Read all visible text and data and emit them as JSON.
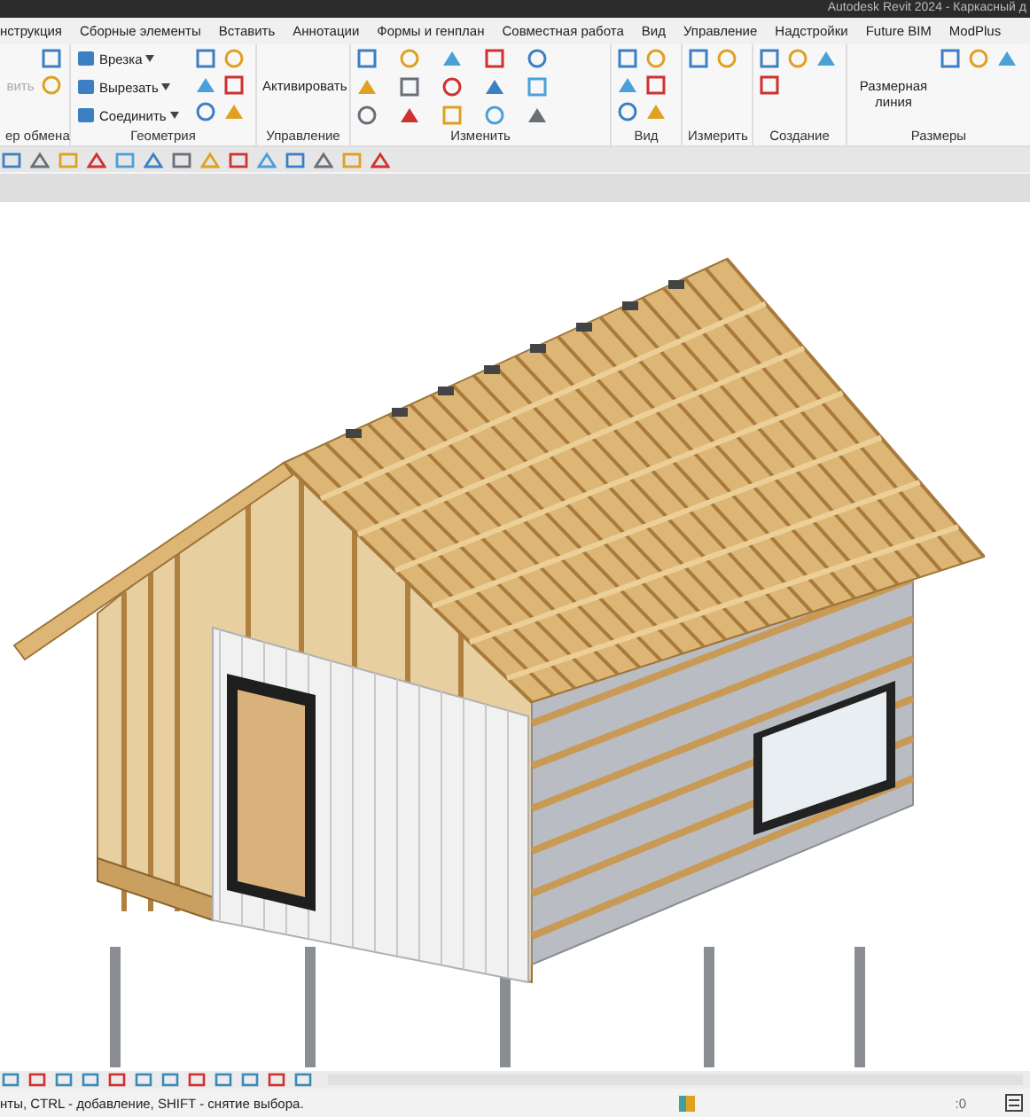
{
  "window": {
    "title": "Autodesk Revit 2024 - Каркасный д"
  },
  "tabs": [
    {
      "label": "нструкция"
    },
    {
      "label": "Сборные элементы"
    },
    {
      "label": "Вставить"
    },
    {
      "label": "Аннотации"
    },
    {
      "label": "Формы и генплан"
    },
    {
      "label": "Совместная работа"
    },
    {
      "label": "Вид"
    },
    {
      "label": "Управление"
    },
    {
      "label": "Надстройки"
    },
    {
      "label": "Future BIM"
    },
    {
      "label": "ModPlus"
    }
  ],
  "ribbon": {
    "panels": [
      {
        "title": "ер обмена",
        "buttons": [
          {
            "label": "вить",
            "kind": "large",
            "disabled": true
          }
        ]
      },
      {
        "title": "Геометрия",
        "buttons": [
          {
            "label": "Врезка",
            "kind": "small",
            "disabled": false
          },
          {
            "label": "Вырезать",
            "kind": "small",
            "disabled": false
          },
          {
            "label": "Соединить",
            "kind": "small",
            "disabled": false
          }
        ]
      },
      {
        "title": "Управление",
        "buttons": [
          {
            "label": "Активировать",
            "kind": "large",
            "disabled": false
          }
        ]
      },
      {
        "title": "Изменить"
      },
      {
        "title": "Вид"
      },
      {
        "title": "Измерить"
      },
      {
        "title": "Создание"
      },
      {
        "title": "Размеры",
        "buttons": [
          {
            "label": "Размерная линия",
            "kind": "large",
            "disabled": false
          }
        ]
      }
    ]
  },
  "status_bar": {
    "message": "нты, CTRL - добавление, SHIFT - снятие выбора.",
    "selection_count": ":0"
  }
}
